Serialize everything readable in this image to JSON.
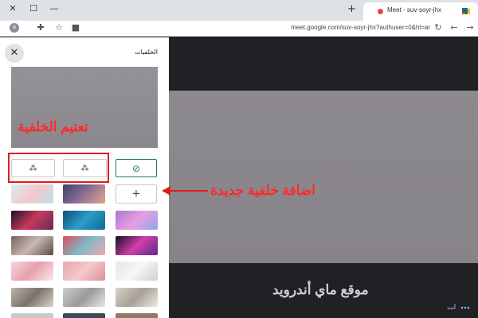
{
  "window": {
    "tab_title": "Meet - suv-soyr-jhx",
    "url": "meet.google.com/suv-soyr-jhx?authuser=0&hl=ar",
    "profile_initial": "a"
  },
  "panel": {
    "title": "الخلفيات",
    "blur_annotation": "تعتيم الخلفية",
    "thumbnails": [
      {
        "name": "beach",
        "colors": [
          "#d8eef3",
          "#f3c8c8",
          "#bfe0ea"
        ]
      },
      {
        "name": "sunset-sky",
        "colors": [
          "#39406e",
          "#8a6f93",
          "#e7a58f"
        ]
      },
      {
        "name": "pink-lightning",
        "colors": [
          "#1d1027",
          "#c43a5c",
          "#6a2a58"
        ]
      },
      {
        "name": "aqua-water",
        "colors": [
          "#0d4f74",
          "#2b9cc8",
          "#0f6a95"
        ]
      },
      {
        "name": "purple-sky",
        "colors": [
          "#a47ad1",
          "#ea9de0",
          "#8fa8ec"
        ]
      },
      {
        "name": "pebbles",
        "colors": [
          "#7a6460",
          "#c8b7b1",
          "#5b4b48"
        ]
      },
      {
        "name": "flowers",
        "colors": [
          "#d84d5d",
          "#7fb9c8",
          "#f3a7b0"
        ]
      },
      {
        "name": "galaxy",
        "colors": [
          "#120c22",
          "#d23fa8",
          "#5b2a8a"
        ]
      },
      {
        "name": "blossoms",
        "colors": [
          "#f6d5db",
          "#e8a0ad",
          "#fbe8eb"
        ]
      },
      {
        "name": "pink-grid",
        "colors": [
          "#e9a4ab",
          "#f4c8cc",
          "#d98f97"
        ]
      },
      {
        "name": "white-room",
        "colors": [
          "#e6e6e6",
          "#f6f6f6",
          "#cfcfcf"
        ]
      },
      {
        "name": "living-room",
        "colors": [
          "#b9b4ad",
          "#7a736b",
          "#d8d3cc"
        ]
      },
      {
        "name": "office",
        "colors": [
          "#cfcfcf",
          "#9a9a9a",
          "#e8e8e8"
        ]
      },
      {
        "name": "kitchen",
        "colors": [
          "#d7d2ca",
          "#a6a097",
          "#efebe4"
        ]
      }
    ]
  },
  "video": {
    "new_background_annotation": "اضافة خلفية جديدة",
    "watermark": "موقع ماي أندرويد",
    "self_label": "أنت"
  }
}
